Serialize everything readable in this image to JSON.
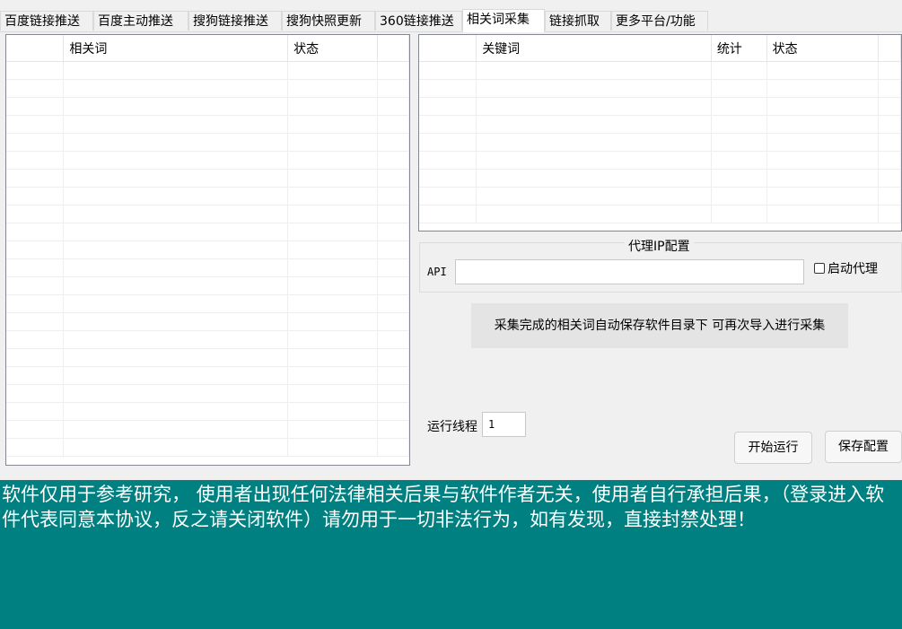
{
  "tabs": [
    {
      "label": "百度链接推送"
    },
    {
      "label": "百度主动推送"
    },
    {
      "label": "搜狗链接推送"
    },
    {
      "label": "搜狗快照更新"
    },
    {
      "label": "360链接推送"
    },
    {
      "label": "相关词采集",
      "active": true
    },
    {
      "label": "链接抓取"
    },
    {
      "label": "更多平台/功能"
    }
  ],
  "left_grid": {
    "columns": [
      "",
      "相关词",
      "状态",
      ""
    ]
  },
  "right_grid": {
    "columns": [
      "",
      "关键词",
      "统计",
      "状态",
      ""
    ]
  },
  "proxy": {
    "legend": "代理IP配置",
    "api_label": "API",
    "api_value": "",
    "enable_label": "启动代理",
    "enable_checked": false
  },
  "notice": "采集完成的相关词自动保存软件目录下  可再次导入进行采集",
  "threads": {
    "label": "运行线程",
    "value": "1"
  },
  "buttons": {
    "start": "开始运行",
    "save": "保存配置"
  },
  "disclaimer": "软件仅用于参考研究，  使用者出现任何法律相关后果与软件作者无关，使用者自行承担后果，（登录进入软件代表同意本协议，反之请关闭软件）请勿用于一切非法行为，如有发现，直接封禁处理！",
  "colors": {
    "footer_bg": "#008080",
    "footer_text": "#ffffff"
  }
}
